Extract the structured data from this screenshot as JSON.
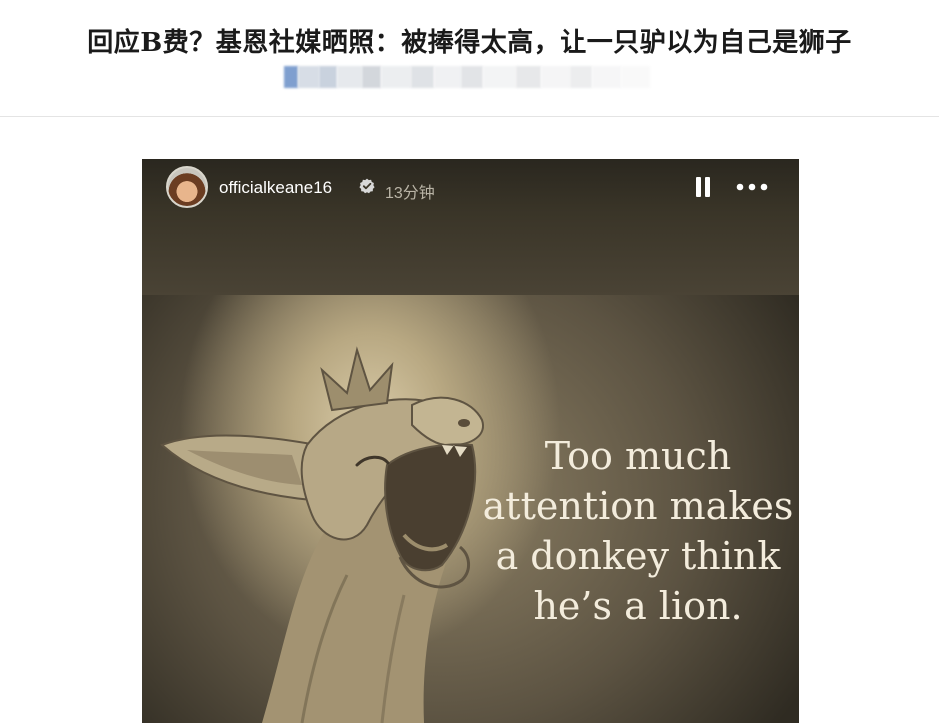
{
  "article": {
    "headline": "回应B费？基恩社媒晒照：被捧得太高，让一只驴以为自己是狮子"
  },
  "story": {
    "username": "officialkeane16",
    "time_ago": "13分钟",
    "quote_lines": [
      "Too much",
      "attention makes",
      "a donkey think",
      "he’s a lion."
    ]
  },
  "icons": {
    "verified": "verified-badge-icon",
    "pause": "pause-icon",
    "more": "more-options-icon"
  },
  "colors": {
    "header_text": "#1a1a1a",
    "story_text": "#ffffff",
    "quote_text": "#f3ecdc"
  }
}
